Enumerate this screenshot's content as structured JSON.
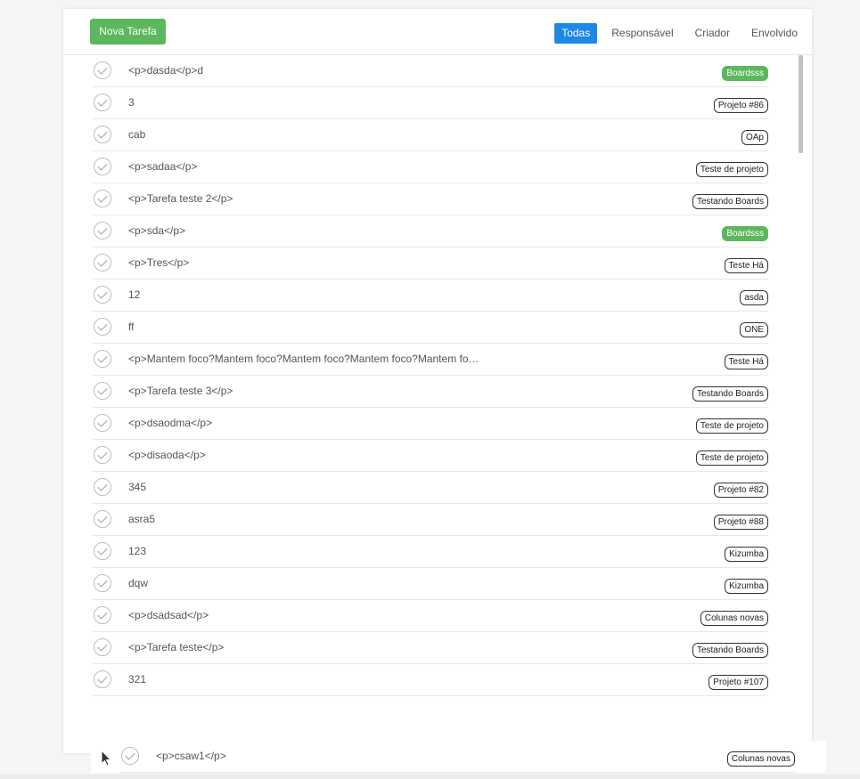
{
  "header": {
    "new_task_label": "Nova Tarefa",
    "filters": [
      {
        "label": "Todas",
        "active": true
      },
      {
        "label": "Responsável",
        "active": false
      },
      {
        "label": "Criador",
        "active": false
      },
      {
        "label": "Envolvido",
        "active": false
      }
    ]
  },
  "colors": {
    "primary_green": "#5cb85c",
    "active_blue": "#1e88e5"
  },
  "tasks": [
    {
      "title": "<p>dasda</p>d",
      "tag": "Boardsss",
      "tag_style": "green"
    },
    {
      "title": "3",
      "tag": "Projeto #86",
      "tag_style": "outline"
    },
    {
      "title": "cab",
      "tag": "OAp",
      "tag_style": "outline"
    },
    {
      "title": "<p>sadaa</p>",
      "tag": "Teste de projeto",
      "tag_style": "outline"
    },
    {
      "title": "<p>Tarefa teste 2</p>",
      "tag": "Testando Boards",
      "tag_style": "outline"
    },
    {
      "title": "<p>sda</p>",
      "tag": "Boardsss",
      "tag_style": "green"
    },
    {
      "title": "<p>Tres</p>",
      "tag": "Teste Há",
      "tag_style": "outline"
    },
    {
      "title": "12",
      "tag": "asda",
      "tag_style": "outline"
    },
    {
      "title": "ff",
      "tag": "ONE",
      "tag_style": "outline"
    },
    {
      "title": "<p>Mantem foco?Mantem foco?Mantem foco?Mantem foco?Mantem fo…",
      "tag": "Teste Há",
      "tag_style": "outline"
    },
    {
      "title": "<p>Tarefa teste 3</p>",
      "tag": "Testando Boards",
      "tag_style": "outline"
    },
    {
      "title": "<p>dsaodma</p>",
      "tag": "Teste de projeto",
      "tag_style": "outline"
    },
    {
      "title": "<p>disaoda</p>",
      "tag": "Teste de projeto",
      "tag_style": "outline"
    },
    {
      "title": "345",
      "tag": "Projeto #82",
      "tag_style": "outline"
    },
    {
      "title": "asra5",
      "tag": "Projeto #88",
      "tag_style": "outline"
    },
    {
      "title": "123",
      "tag": "Kizumba",
      "tag_style": "outline"
    },
    {
      "title": "dqw",
      "tag": "Kizumba",
      "tag_style": "outline"
    },
    {
      "title": "<p>dsadsad</p>",
      "tag": "Colunas novas",
      "tag_style": "outline"
    },
    {
      "title": "<p>Tarefa teste</p>",
      "tag": "Testando Boards",
      "tag_style": "outline"
    },
    {
      "title": "321",
      "tag": "Projeto #107",
      "tag_style": "outline"
    }
  ],
  "dragging_task": {
    "title": "<p>csaw1</p>",
    "tag": "Colunas novas",
    "tag_style": "outline"
  },
  "icons": {
    "complete": "check-circle-icon",
    "cursor": "mouse-pointer-icon"
  }
}
